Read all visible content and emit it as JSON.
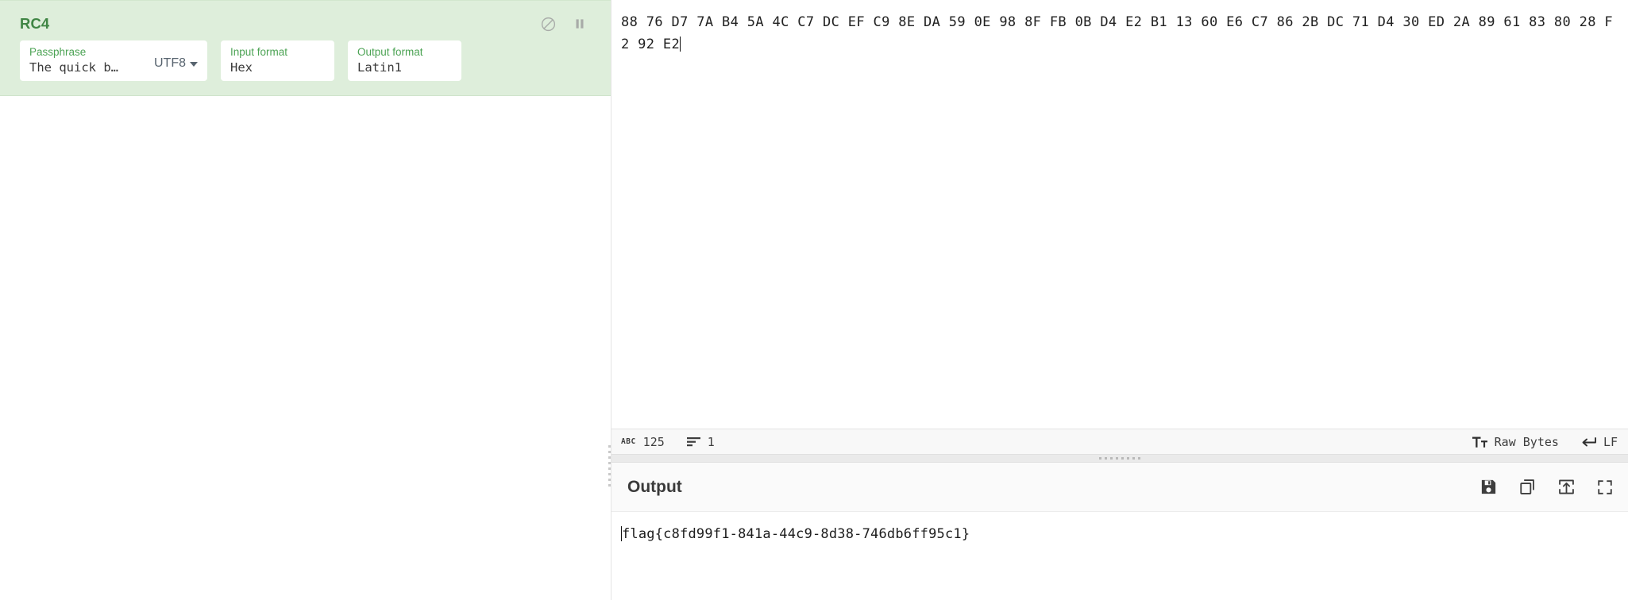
{
  "recipe": {
    "operation": {
      "title": "RC4",
      "icons": [
        {
          "name": "disable-icon",
          "glyph": "circle-slash"
        },
        {
          "name": "breakpoint-pause-icon",
          "glyph": "pause"
        }
      ],
      "args": {
        "passphrase": {
          "label": "Passphrase",
          "value": "The quick b…",
          "encoding": "UTF8"
        },
        "input_format": {
          "label": "Input format",
          "value": "Hex"
        },
        "output_format": {
          "label": "Output format",
          "value": "Latin1"
        }
      }
    }
  },
  "input": {
    "value": "88 76 D7 7A B4 5A 4C C7 DC EF C9 8E DA 59 0E 98 8F FB 0B D4 E2 B1 13 60 E6 C7 86 2B DC 71 D4 30 ED 2A 89 61 83 80 28 F2 92 E2",
    "status": {
      "length_icon": "abc",
      "length_label": "ABC",
      "length": "125",
      "lines_icon": "lines-icon",
      "lines": "1",
      "encoding_icon": "font-size-icon",
      "encoding": "Raw Bytes",
      "eol_icon": "enter-arrow-icon",
      "eol": "LF"
    }
  },
  "output": {
    "title": "Output",
    "value": "flag{c8fd99f1-841a-44c9-8d38-746db6ff95c1}",
    "icons": [
      {
        "name": "save-icon",
        "label": "Save output to file"
      },
      {
        "name": "copy-icon",
        "label": "Copy raw output to the clipboard"
      },
      {
        "name": "replace-input-icon",
        "label": "Replace input with output"
      },
      {
        "name": "maximise-icon",
        "label": "Maximise output pane"
      }
    ]
  },
  "theme": {
    "operation_bg": "#deeedb",
    "operation_title": "#3f8544",
    "arg_label": "#4ca354",
    "status_bar_bg": "#f8f8f8",
    "output_head_bg": "#fafafa"
  }
}
